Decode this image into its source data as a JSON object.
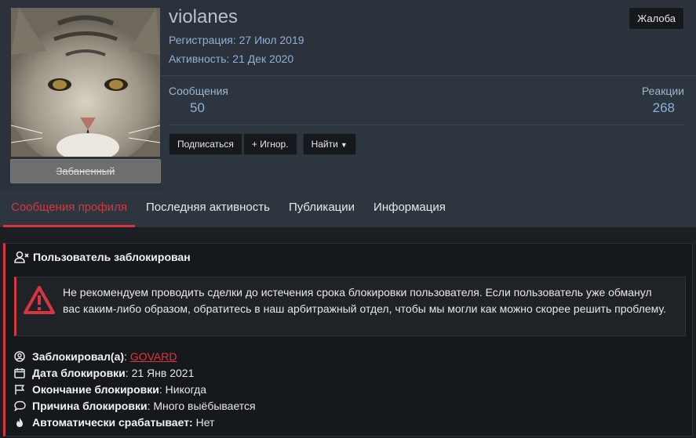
{
  "profile": {
    "username": "violanes",
    "registration": "Регистрация: 27 Июл 2019",
    "activity": "Активность: 21 Дек 2020",
    "banned_badge": "Забаненный",
    "report_button": "Жалоба",
    "stats": {
      "messages_label": "Сообщения",
      "messages_value": "50",
      "reactions_label": "Реакции",
      "reactions_value": "268"
    },
    "buttons": {
      "follow": "Подписаться",
      "ignore": "+ Игнор.",
      "find": "Найти"
    }
  },
  "tabs": [
    {
      "label": "Сообщения профиля",
      "active": true
    },
    {
      "label": "Последняя активность",
      "active": false
    },
    {
      "label": "Публикации",
      "active": false
    },
    {
      "label": "Информация",
      "active": false
    }
  ],
  "ban": {
    "title": "Пользователь заблокирован",
    "warning": "Не рекомендуем проводить сделки до истечения срока блокировки пользователя. Если пользователь уже обманул вас каким-либо образом, обратитесь в наш арбитражный отдел, чтобы мы могли как можно скорее решить проблему.",
    "banned_by_label": "Заблокировал(а)",
    "banned_by_value": "GOVARD",
    "date_label": "Дата блокировки",
    "date_value": "21 Янв 2021",
    "end_label": "Окончание блокировки",
    "end_value": "Никогда",
    "reason_label": "Причина блокировки",
    "reason_value": "Много выёбывается",
    "auto_label": "Автоматически срабатывает:",
    "auto_value": "Нет"
  },
  "colors": {
    "accent": "#d8363f",
    "link_blue": "#8fb0d4",
    "panel": "#2b323b",
    "background": "#1b1f23"
  },
  "icons": {
    "ban_title": "user-x-icon",
    "warning": "warning-triangle-icon",
    "banned_by": "user-circle-icon",
    "date": "calendar-icon",
    "end": "flag-icon",
    "reason": "comment-icon",
    "auto": "fire-icon"
  }
}
